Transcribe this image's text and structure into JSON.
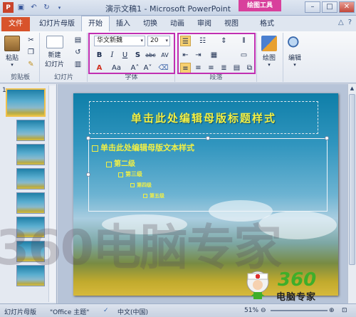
{
  "window": {
    "title": "演示文稿1 - Microsoft PowerPoint",
    "context_tab": "绘图工具",
    "qat": [
      "save-icon",
      "undo-icon",
      "redo-icon"
    ]
  },
  "tabs": [
    {
      "label": "文件"
    },
    {
      "label": "幻灯片母版"
    },
    {
      "label": "开始"
    },
    {
      "label": "插入"
    },
    {
      "label": "切换"
    },
    {
      "label": "动画"
    },
    {
      "label": "审阅"
    },
    {
      "label": "视图"
    },
    {
      "label": "格式"
    }
  ],
  "ribbon": {
    "clipboard": {
      "paste": "粘贴",
      "label": "剪贴板"
    },
    "slides": {
      "new_slide": "新建",
      "new_slide2": "幻灯片",
      "label": "幻灯片"
    },
    "font": {
      "name": "华文新魏",
      "size": "20",
      "label": "字体"
    },
    "paragraph": {
      "label": "段落"
    },
    "drawing": {
      "label": "绘图"
    },
    "editing": {
      "label": "编辑"
    }
  },
  "slide": {
    "title": "单击此处编辑母版标题样式",
    "levels": [
      "单击此处编辑母版文本样式",
      "第二级",
      "第三级",
      "第四级",
      "第五级"
    ]
  },
  "slide_pane": {
    "first_number": "1"
  },
  "status": {
    "view": "幻灯片母版",
    "theme": "\"Office 主题\"",
    "language": "中文(中国)",
    "zoom": "51%"
  },
  "watermark": {
    "text": "360电脑专家",
    "logo_num": "360",
    "logo_text": "电脑专家"
  }
}
